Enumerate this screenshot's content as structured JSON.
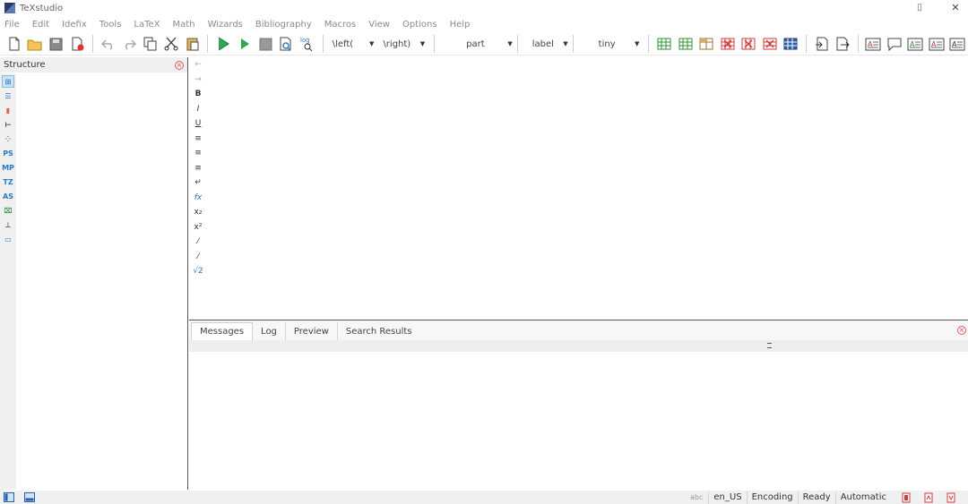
{
  "window": {
    "title": "TeXstudio",
    "controls": {
      "minimize": "⎯",
      "restore": "⌷",
      "close": "✕"
    }
  },
  "menu": [
    "File",
    "Edit",
    "Idefix",
    "Tools",
    "LaTeX",
    "Math",
    "Wizards",
    "Bibliography",
    "Macros",
    "View",
    "Options",
    "Help"
  ],
  "toolbar": {
    "combos": {
      "left": "\\left(",
      "right": "\\right)",
      "part": "part",
      "label": "label",
      "size": "tiny"
    },
    "log_label": "log"
  },
  "structure": {
    "title": "Structure",
    "side_icons": [
      {
        "icon": "structure-tree-icon",
        "glyph": "⊞"
      },
      {
        "icon": "toc-icon",
        "glyph": "☰"
      },
      {
        "icon": "bookmark-icon",
        "glyph": "▮"
      },
      {
        "icon": "symbols-icon",
        "glyph": "⊢"
      },
      {
        "icon": "grid-icon",
        "glyph": "⁘"
      },
      {
        "icon": "pstricks-icon",
        "glyph": "PS"
      },
      {
        "icon": "metapost-icon",
        "glyph": "MP"
      },
      {
        "icon": "tikz-icon",
        "glyph": "TZ"
      },
      {
        "icon": "asymptote-icon",
        "glyph": "AS"
      },
      {
        "icon": "insert-image-icon",
        "glyph": "⌧"
      },
      {
        "icon": "bottom-icon",
        "glyph": "⊥"
      },
      {
        "icon": "page-icon",
        "glyph": "▭"
      }
    ]
  },
  "edit_icons": [
    {
      "icon": "arrow-left-icon",
      "glyph": "←"
    },
    {
      "icon": "arrow-right-icon",
      "glyph": "→"
    },
    {
      "icon": "bold-icon",
      "glyph": "B"
    },
    {
      "icon": "italic-icon",
      "glyph": "I"
    },
    {
      "icon": "underline-icon",
      "glyph": "U"
    },
    {
      "icon": "align-left-icon",
      "glyph": "≡"
    },
    {
      "icon": "align-center-icon",
      "glyph": "≡"
    },
    {
      "icon": "align-right-icon",
      "glyph": "≡"
    },
    {
      "icon": "new-line-icon",
      "glyph": "↵"
    },
    {
      "icon": "math-mode-icon",
      "glyph": "fx"
    },
    {
      "icon": "subscript-icon",
      "glyph": "x₂"
    },
    {
      "icon": "superscript-icon",
      "glyph": "x²"
    },
    {
      "icon": "fraction-icon",
      "glyph": "⁄"
    },
    {
      "icon": "dfrac-icon",
      "glyph": "⁄"
    },
    {
      "icon": "sqrt-icon",
      "glyph": "√2"
    }
  ],
  "bottom_tabs": [
    "Messages",
    "Log",
    "Preview",
    "Search Results"
  ],
  "status": {
    "spell": "abc",
    "language": "en_US",
    "encoding": "Encoding",
    "state": "Ready",
    "mode": "Automatic"
  },
  "colors": {
    "accent_blue": "#2b78c4",
    "run_green": "#2fa84f",
    "close_red": "#e25b5b",
    "table_green": "#2f8f3a",
    "table_red": "#d23b3b"
  }
}
